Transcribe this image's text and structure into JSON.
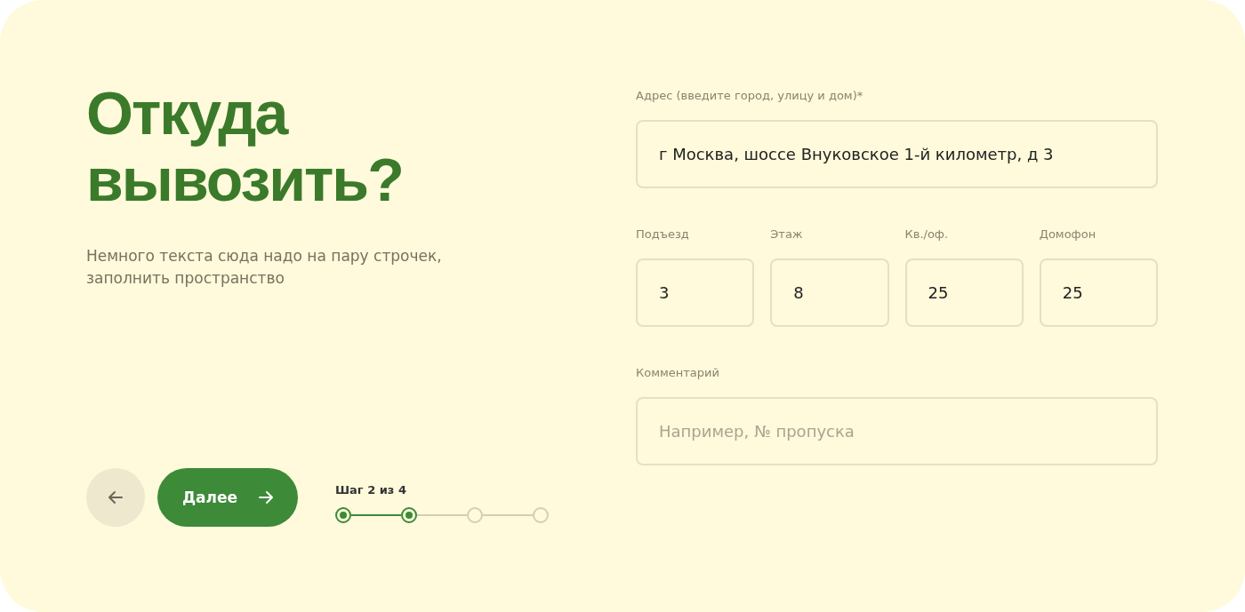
{
  "title": "Откуда вывозить?",
  "subtitle": "Немного текста сюда надо на пару строчек, заполнить пространство",
  "next_button": {
    "label": "Далее"
  },
  "progress": {
    "label": "Шаг 2 из 4",
    "steps": [
      {
        "done": true
      },
      {
        "done": true
      },
      {
        "done": false
      },
      {
        "done": false
      }
    ]
  },
  "address": {
    "label": "Адрес (введите город, улицу и дом)*",
    "value": "г Москва, шоссе Внуковское 1-й километр, д 3"
  },
  "details": [
    {
      "label": "Подъезд",
      "value": "3"
    },
    {
      "label": "Этаж",
      "value": "8"
    },
    {
      "label": "Кв./оф.",
      "value": "25"
    },
    {
      "label": "Домофон",
      "value": "25"
    }
  ],
  "comment": {
    "label": "Комментарий",
    "placeholder": "Например, № пропуска"
  }
}
